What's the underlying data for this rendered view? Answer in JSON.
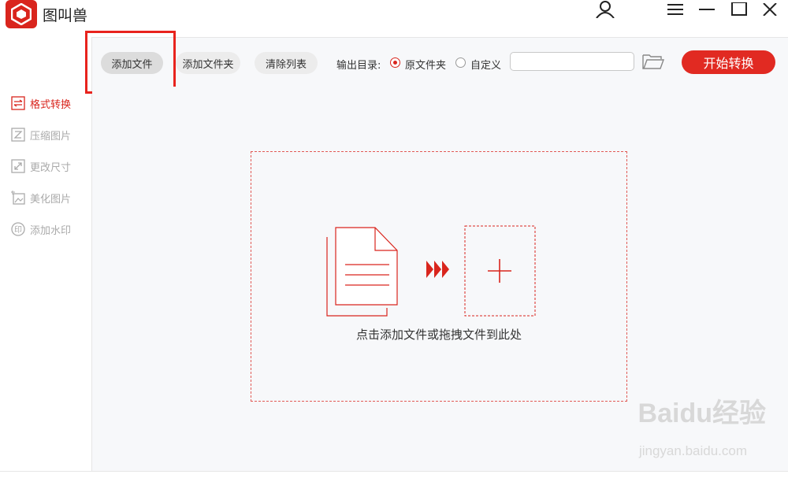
{
  "app": {
    "title": "图叫兽"
  },
  "toolbar": {
    "add_file": "添加文件",
    "add_folder": "添加文件夹",
    "clear_list": "清除列表",
    "output_label": "输出目录:",
    "radio_original": "原文件夹",
    "radio_custom": "自定义",
    "path_value": "",
    "start": "开始转换"
  },
  "sidebar": {
    "items": [
      {
        "label": "格式转换",
        "icon": "swap-icon",
        "active": true
      },
      {
        "label": "压缩图片",
        "icon": "compress-icon",
        "active": false
      },
      {
        "label": "更改尺寸",
        "icon": "resize-icon",
        "active": false
      },
      {
        "label": "美化图片",
        "icon": "beautify-icon",
        "active": false
      },
      {
        "label": "添加水印",
        "icon": "watermark-icon",
        "active": false
      }
    ]
  },
  "dropzone": {
    "text": "点击添加文件或拖拽文件到此处"
  },
  "watermark": {
    "text": "Baidu经验",
    "sub": "jingyan.baidu.com"
  },
  "colors": {
    "accent": "#e12a22",
    "highlight": "#e8231d",
    "muted": "#aaaaaa"
  }
}
